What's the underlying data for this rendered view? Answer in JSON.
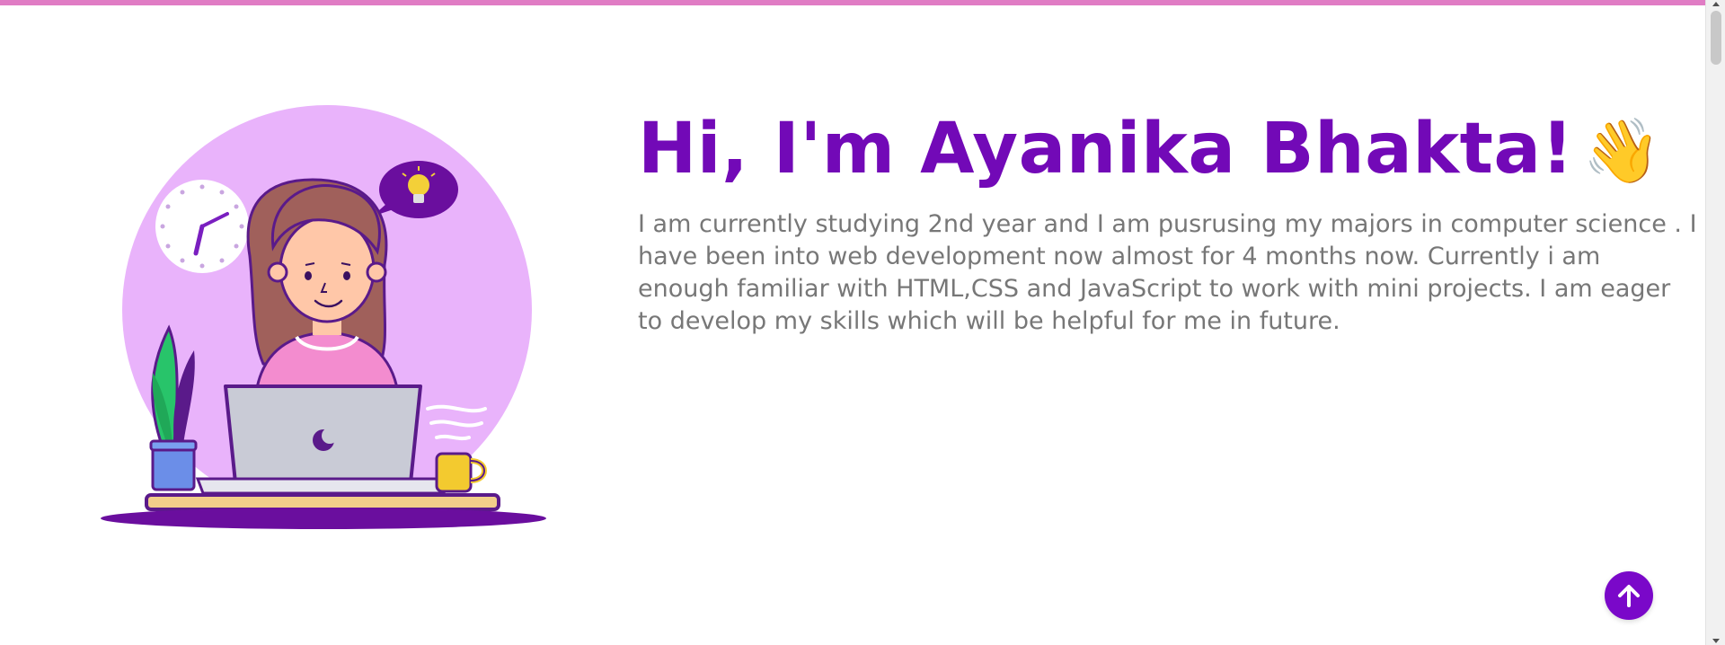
{
  "colors": {
    "accent": "#7209b7",
    "top_bar": "#e07cc4",
    "body_text": "#777777",
    "button_bg": "#7a08c9"
  },
  "hero": {
    "title": "Hi, I'm Ayanika Bhakta!",
    "wave_emoji": "👋",
    "description": "I am currently studying 2nd year and I am pusrusing my majors in computer science . I have been into web development now almost for 4 months now. Currently i am enough familiar with HTML,CSS and JavaScript to work with mini projects. I am eager to develop my skills which will be helpful for me in future.",
    "illustration": "girl-working-on-laptop-illustration"
  },
  "scroll_top_button": {
    "icon": "arrow-up-icon"
  },
  "scrollbar": {
    "icon_up": "scroll-up-arrow-icon",
    "icon_down": "scroll-down-arrow-icon"
  }
}
